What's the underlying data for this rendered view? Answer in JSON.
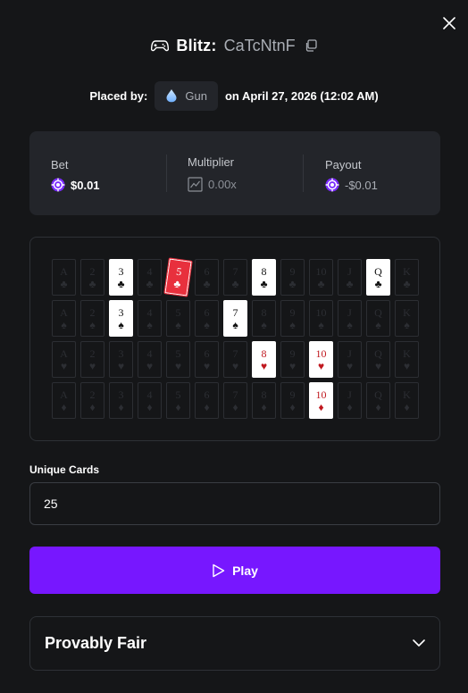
{
  "header": {
    "game": "Blitz:",
    "bet_id": "CaTcNtnF"
  },
  "placed": {
    "label": "Placed by:",
    "user": "Gun",
    "date": "on April 27, 2026 (12:02 AM)"
  },
  "stats": {
    "bet_label": "Bet",
    "bet_value": "$0.01",
    "multiplier_label": "Multiplier",
    "multiplier_value": "0.00x",
    "payout_label": "Payout",
    "payout_value": "-$0.01"
  },
  "board": {
    "ranks": [
      "A",
      "2",
      "3",
      "4",
      "5",
      "6",
      "7",
      "8",
      "9",
      "10",
      "J",
      "Q",
      "K"
    ],
    "suits": [
      {
        "name": "clubs",
        "glyph": "♣",
        "color": "black"
      },
      {
        "name": "spades",
        "glyph": "♠",
        "color": "black"
      },
      {
        "name": "hearts",
        "glyph": "♥",
        "color": "red"
      },
      {
        "name": "diamonds",
        "glyph": "♦",
        "color": "red"
      }
    ],
    "revealed": [
      {
        "suit": 0,
        "rank": "3"
      },
      {
        "suit": 0,
        "rank": "8"
      },
      {
        "suit": 0,
        "rank": "Q"
      },
      {
        "suit": 1,
        "rank": "3"
      },
      {
        "suit": 1,
        "rank": "7"
      },
      {
        "suit": 2,
        "rank": "8"
      },
      {
        "suit": 2,
        "rank": "10"
      },
      {
        "suit": 3,
        "rank": "10"
      }
    ],
    "flagged": {
      "suit": 0,
      "rank": "5",
      "color": "#e8303d"
    }
  },
  "form": {
    "unique_cards_label": "Unique Cards",
    "unique_cards_value": "25",
    "play_label": "Play"
  },
  "provably_fair": {
    "label": "Provably Fair"
  },
  "colors": {
    "accent": "#7717ff",
    "background": "#151618",
    "panel": "#23252a",
    "token": "#7b2cff"
  },
  "icons": {
    "close": "close-icon",
    "gamepad": "gamepad-icon",
    "copy": "copy-icon",
    "avatar": "droplet-icon",
    "token": "chip-icon",
    "multiplier": "chart-icon",
    "play": "play-icon",
    "chevron": "chevron-down-icon"
  }
}
